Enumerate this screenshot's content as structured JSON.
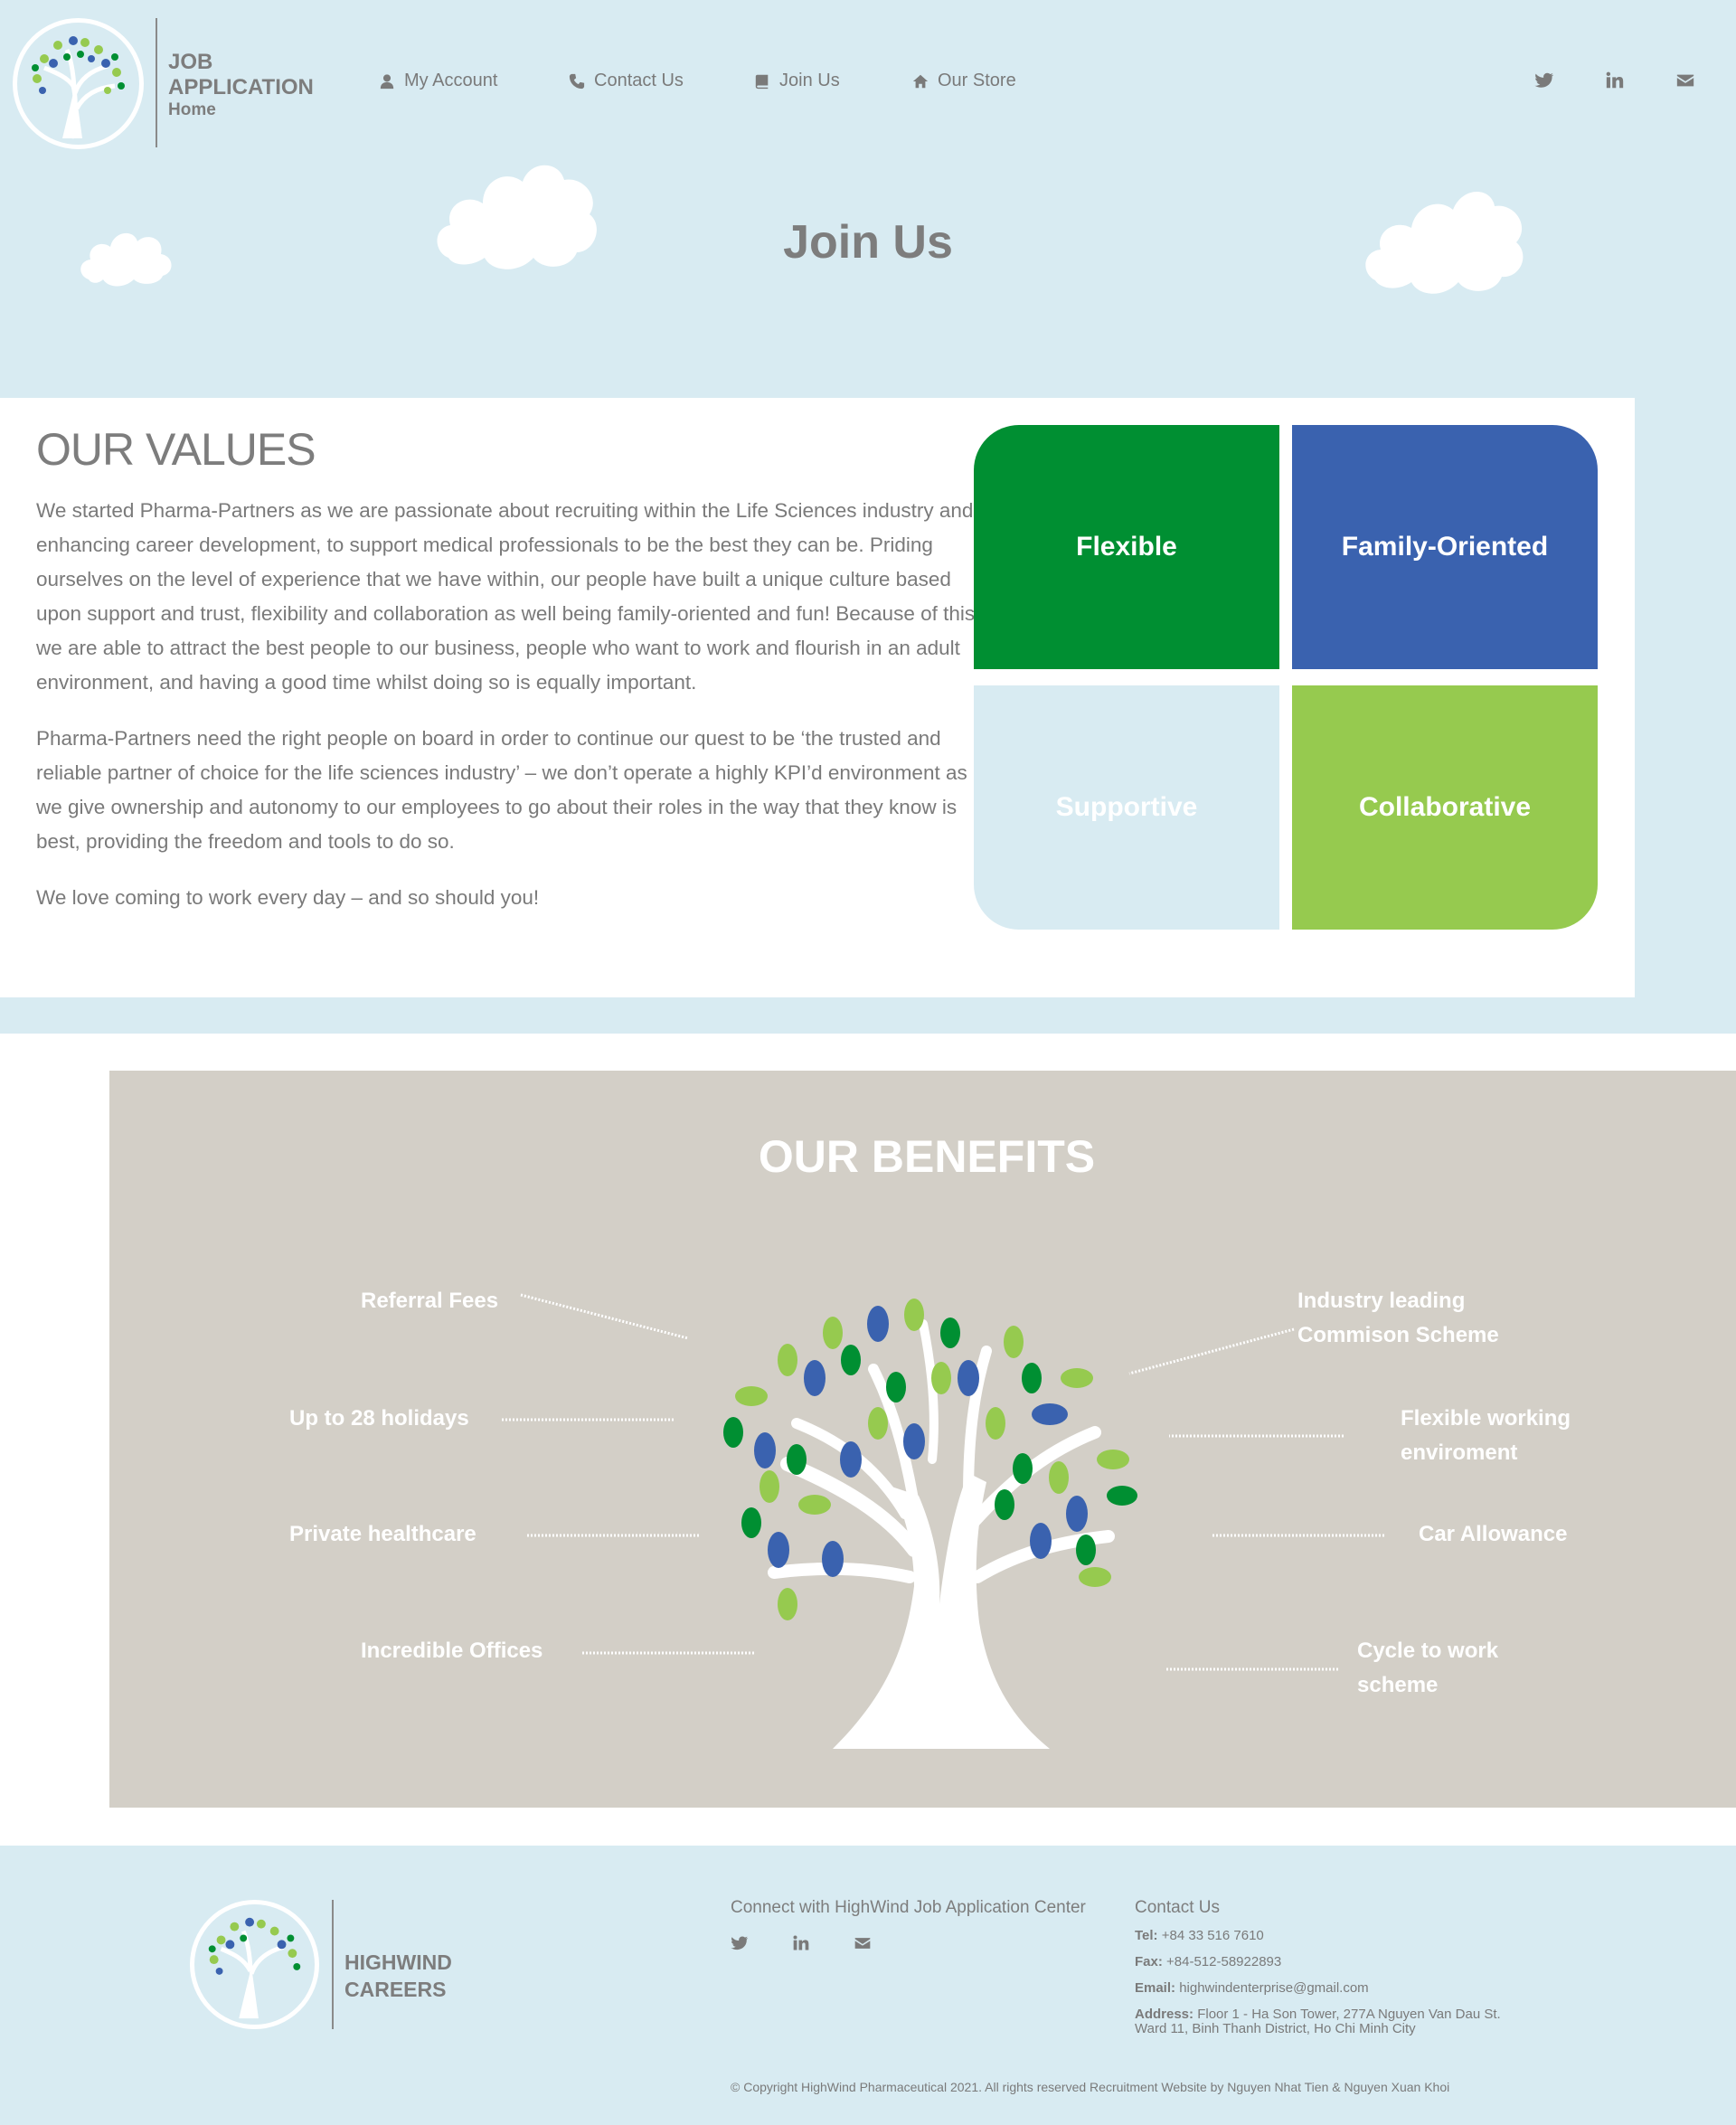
{
  "header": {
    "brand_line1": "JOB",
    "brand_line2": "APPLICATION",
    "brand_sub": "Home",
    "nav": [
      {
        "label": "My Account",
        "icon": "user-icon"
      },
      {
        "label": "Contact Us",
        "icon": "phone-icon"
      },
      {
        "label": "Join Us",
        "icon": "book-icon"
      },
      {
        "label": "Our Store",
        "icon": "home-icon"
      }
    ],
    "social": [
      "twitter-icon",
      "linkedin-icon",
      "envelope-icon"
    ]
  },
  "hero": {
    "title": "Join Us"
  },
  "values": {
    "heading": "OUR VALUES",
    "paragraphs": [
      "We started Pharma-Partners as we are passionate about recruiting within the Life Sciences industry and enhancing career development, to support medical professionals to be the best they can be. Priding ourselves on the level of experience that we have within, our people have built a unique culture based upon support and trust, flexibility and collaboration as well being family-oriented and fun! Because of this we are able to attract the best people to our business, people who want to work and flourish in an adult environment, and having a good time whilst doing so is equally important.",
      "Pharma-Partners need the right people on board in order to continue our quest to be ‘the trusted and reliable partner of choice for the life sciences industry’ – we don’t operate a highly KPI’d environment as we give ownership and autonomy to our employees to go about their roles in the way that they know is best, providing the freedom and tools to do so.",
      "We love coming to work every day – and so should you!"
    ],
    "tiles": [
      "Flexible",
      "Family-Oriented",
      "Supportive",
      "Collaborative"
    ],
    "tile_colors": [
      "#008f32",
      "#3a62af",
      "#d8ebf2",
      "#96ca4f"
    ]
  },
  "benefits": {
    "heading": "OUR BENEFITS",
    "left": [
      "Referral Fees",
      "Up to 28 holidays",
      "Private healthcare",
      "Incredible Offices"
    ],
    "right": [
      [
        "Industry leading",
        "Commison Scheme"
      ],
      [
        "Flexible working",
        "enviroment"
      ],
      [
        "Car Allowance"
      ],
      [
        "Cycle to work",
        "scheme"
      ]
    ]
  },
  "footer": {
    "brand_line1": "HIGHWIND",
    "brand_line2": "CAREERS",
    "connect": "Connect with HighWind Job Application Center",
    "contact_heading": "Contact Us",
    "tel_label": "Tel:",
    "tel": "+84 33 516 7610",
    "fax_label": "Fax:",
    "fax": "+84-512-58922893",
    "email_label": "Email:",
    "email": "highwindenterprise@gmail.com",
    "address_label": "Address:",
    "address_line1": "Floor 1 - Ha Son Tower, 277A Nguyen Van Dau St.",
    "address_line2": "Ward 11, Binh Thanh District, Ho Chi Minh City",
    "copyright": "© Copyright HighWind Pharmaceutical 2021. All rights reserved Recruitment Website by Nguyen Nhat Tien & Nguyen Xuan Khoi"
  },
  "colors": {
    "page_bg": "#d8ebf2",
    "text": "#7a7a7a",
    "benefits_bg": "#d3cfc7",
    "green": "#008f32",
    "blue": "#3a62af",
    "lime": "#96ca4f"
  }
}
